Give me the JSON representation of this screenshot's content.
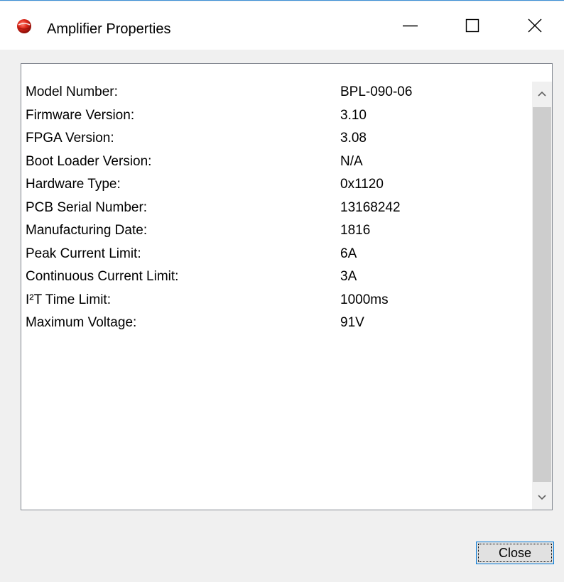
{
  "window": {
    "title": "Amplifier Properties",
    "icon": "red-sphere-app-icon",
    "accent_color": "#0078d7"
  },
  "titlebar_buttons": {
    "minimize_icon": "minimize-icon",
    "maximize_icon": "maximize-icon",
    "close_icon": "close-icon"
  },
  "properties": [
    {
      "label": "Model Number:",
      "value": "BPL-090-06"
    },
    {
      "label": "Firmware Version:",
      "value": "3.10"
    },
    {
      "label": "FPGA Version:",
      "value": "3.08"
    },
    {
      "label": "Boot Loader Version:",
      "value": "N/A"
    },
    {
      "label": "Hardware Type:",
      "value": "0x1120"
    },
    {
      "label": "PCB Serial Number:",
      "value": "13168242"
    },
    {
      "label": "Manufacturing Date:",
      "value": "1816"
    },
    {
      "label": "Peak Current Limit:",
      "value": "6A"
    },
    {
      "label": "Continuous Current Limit:",
      "value": "3A"
    },
    {
      "label": "I²T Time Limit:",
      "value": "1000ms"
    },
    {
      "label": "Maximum Voltage:",
      "value": "91V"
    }
  ],
  "scrollbar": {
    "up_icon": "chevron-up-icon",
    "down_icon": "chevron-down-icon"
  },
  "buttons": {
    "close_label": "Close"
  }
}
